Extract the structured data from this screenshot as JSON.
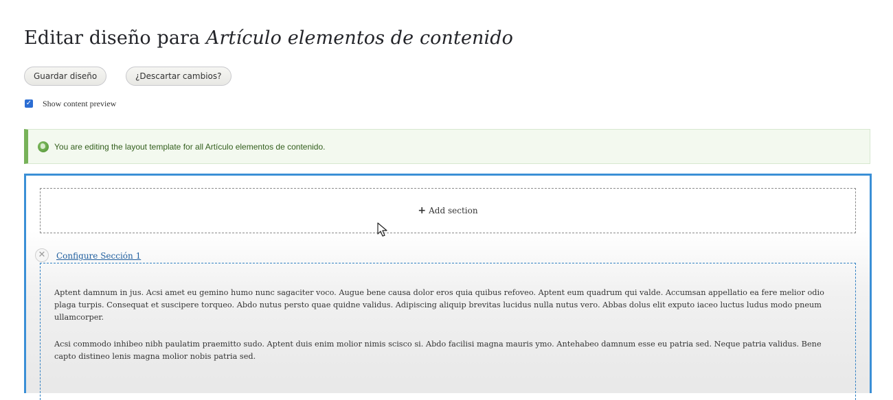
{
  "header": {
    "title_prefix": "Editar diseño para ",
    "title_entity": "Artículo elementos de contenido"
  },
  "actions": {
    "save_label": "Guardar diseño",
    "discard_label": "¿Descartar cambios?"
  },
  "preview": {
    "label": "Show content preview",
    "checked": true
  },
  "message": {
    "text": "You are editing the layout template for all Artículo elementos de contenido.",
    "icon": "globe-icon"
  },
  "layout_builder": {
    "add_section_label": "Add section",
    "section": {
      "configure_label": "Configure Sección 1",
      "paragraphs": [
        "Aptent damnum in jus. Acsi amet eu gemino humo nunc sagaciter voco. Augue bene causa dolor eros quia quibus refoveo. Aptent eum quadrum qui valde. Accumsan appellatio ea fere melior odio plaga turpis. Consequat et suscipere torqueo. Abdo nutus persto quae quidne validus. Adipiscing aliquip brevitas lucidus nulla nutus vero. Abbas dolus elit exputo iaceo luctus ludus modo pneum ullamcorper.",
        "Acsi commodo inhibeo nibh paulatim praemitto sudo. Aptent duis enim molior nimis scisco si. Abdo facilisi magna mauris ymo. Antehabeo damnum esse eu patria sed. Neque patria validus. Bene capto distineo lenis magna molior nobis patria sed."
      ]
    }
  },
  "colors": {
    "accent_blue": "#3a8fd6",
    "message_green": "#77b259",
    "link_blue": "#1f5e9e"
  }
}
